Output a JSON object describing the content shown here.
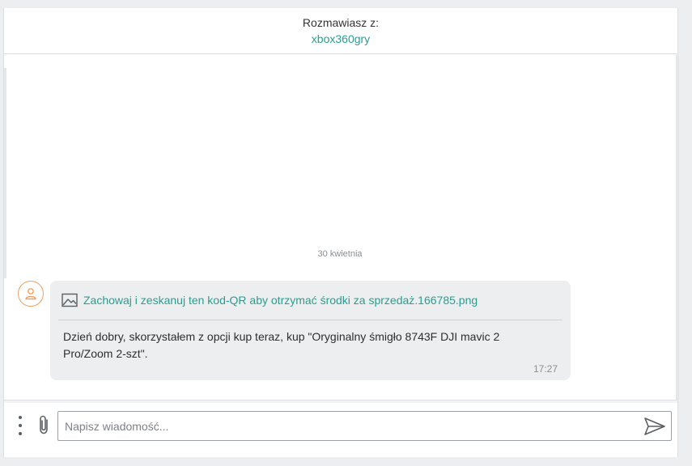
{
  "header": {
    "label": "Rozmawiasz z:",
    "username": "xbox360gry"
  },
  "conversation": {
    "date_separator": "30 kwietnia",
    "messages": [
      {
        "attachment_name": "Zachowaj i zeskanuj ten kod-QR aby otrzymać środki za sprzedaż.166785.png",
        "text": "Dzień dobry, skorzystałem z opcji kup teraz, kup \"Oryginalny śmigło 8743F DJI mavic 2 Pro/Zoom 2-szt\".",
        "time": "17:27",
        "avatar_icon": "user-icon",
        "attachment_icon": "image-icon"
      }
    ]
  },
  "composer": {
    "placeholder": "Napisz wiadomość...",
    "value": "",
    "menu_icon": "kebab-menu-icon",
    "attach_icon": "paperclip-icon",
    "send_icon": "send-icon"
  },
  "colors": {
    "accent": "#2a9d8f",
    "avatar_border": "#f0a060",
    "bubble_bg": "#eceef0"
  }
}
